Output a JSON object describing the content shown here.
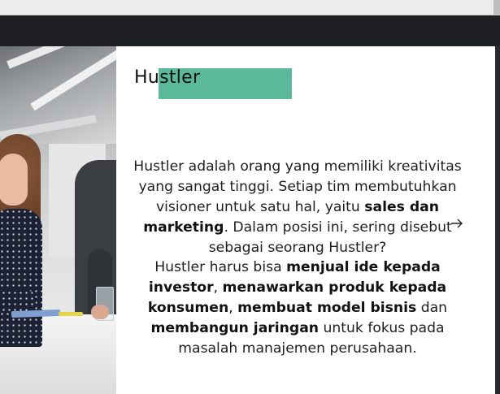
{
  "slide": {
    "title": "Hustler",
    "accent_color": "#5cb89a",
    "paragraph1": {
      "part1": "Hustler adalah orang yang memiliki kreativitas yang sangat tinggi. Setiap tim membutuhkan visioner untuk satu hal, yaitu ",
      "bold1": "sales dan marketing",
      "part2": ". Dalam posisi ini, sering disebut sebagai seorang Hustler?"
    },
    "paragraph2": {
      "part1": "Hustler harus bisa ",
      "bold1": "menjual ide kepada investor",
      "part2": ", ",
      "bold2": "menawarkan produk kepada konsumen",
      "part3": ", ",
      "bold3": "membuat model bisnis",
      "part4": " dan ",
      "bold4": "membangun jaringan",
      "part5": " untuk fokus pada masalah manajemen perusahaan."
    }
  },
  "icons": {
    "cursor": "arrow-cursor-icon",
    "photo": "presenter-photo"
  }
}
